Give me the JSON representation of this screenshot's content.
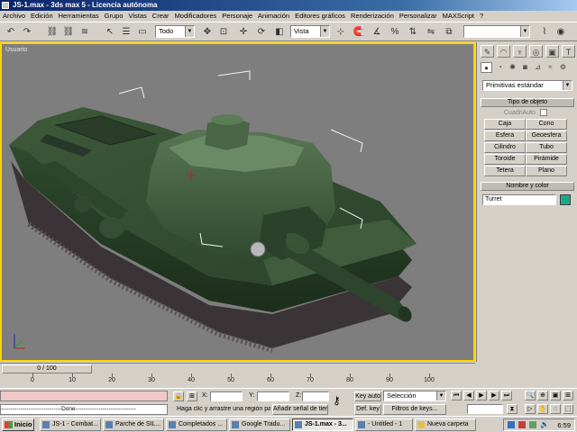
{
  "window": {
    "title": "JS-1.max - 3ds max 5 - Licencia autónoma"
  },
  "menu": [
    "Archivo",
    "Edición",
    "Herramientas",
    "Grupo",
    "Vistas",
    "Crear",
    "Modificadores",
    "Personaje",
    "Animación",
    "Editores gráficos",
    "Renderización",
    "Personalizar",
    "MAXScript",
    "?"
  ],
  "toolbar": {
    "selection_filter": "Todo",
    "coord_system": "Vista",
    "named_selection": ""
  },
  "viewport": {
    "label": "Usuario"
  },
  "command_panel": {
    "category": "Primitivas estándar",
    "object_type_title": "Tipo de objeto",
    "autogrid": "CuadriAuto",
    "buttons": [
      "Caja",
      "Cono",
      "Esfera",
      "Geoesfera",
      "Cilindro",
      "Tubo",
      "Toroide",
      "Pirámide",
      "Tetera",
      "Plano"
    ],
    "name_color_title": "Nombre y color",
    "object_name": "Turret",
    "object_color": "#1aa88a"
  },
  "timeline": {
    "frame_display": "0 / 100",
    "ticks": [
      "0",
      "10",
      "20",
      "30",
      "40",
      "50",
      "60",
      "70",
      "80",
      "90",
      "100"
    ]
  },
  "status": {
    "maxscript_result": "-------------------------------Done-------------------------------",
    "prompt": "Haga clic y arrastre una región para",
    "add_time_tag": "Añadir señal de tiempo",
    "x_label": "X:",
    "y_label": "Y:",
    "z_label": "Z:",
    "key_auto": "Key auto",
    "def_key": "Def. key",
    "key_mode": "Selección",
    "key_filters": "Filtros de keys..."
  },
  "taskbar": {
    "start": "Inicio",
    "tasks": [
      "JS-1 - Combat...",
      "Parche de SIL...",
      "Completados ...",
      "Google Tradu...",
      "JS-1.max - 3...",
      "- Untitled - 1",
      "Nueva carpeta"
    ],
    "active_task": 4,
    "clock": "6:59"
  }
}
